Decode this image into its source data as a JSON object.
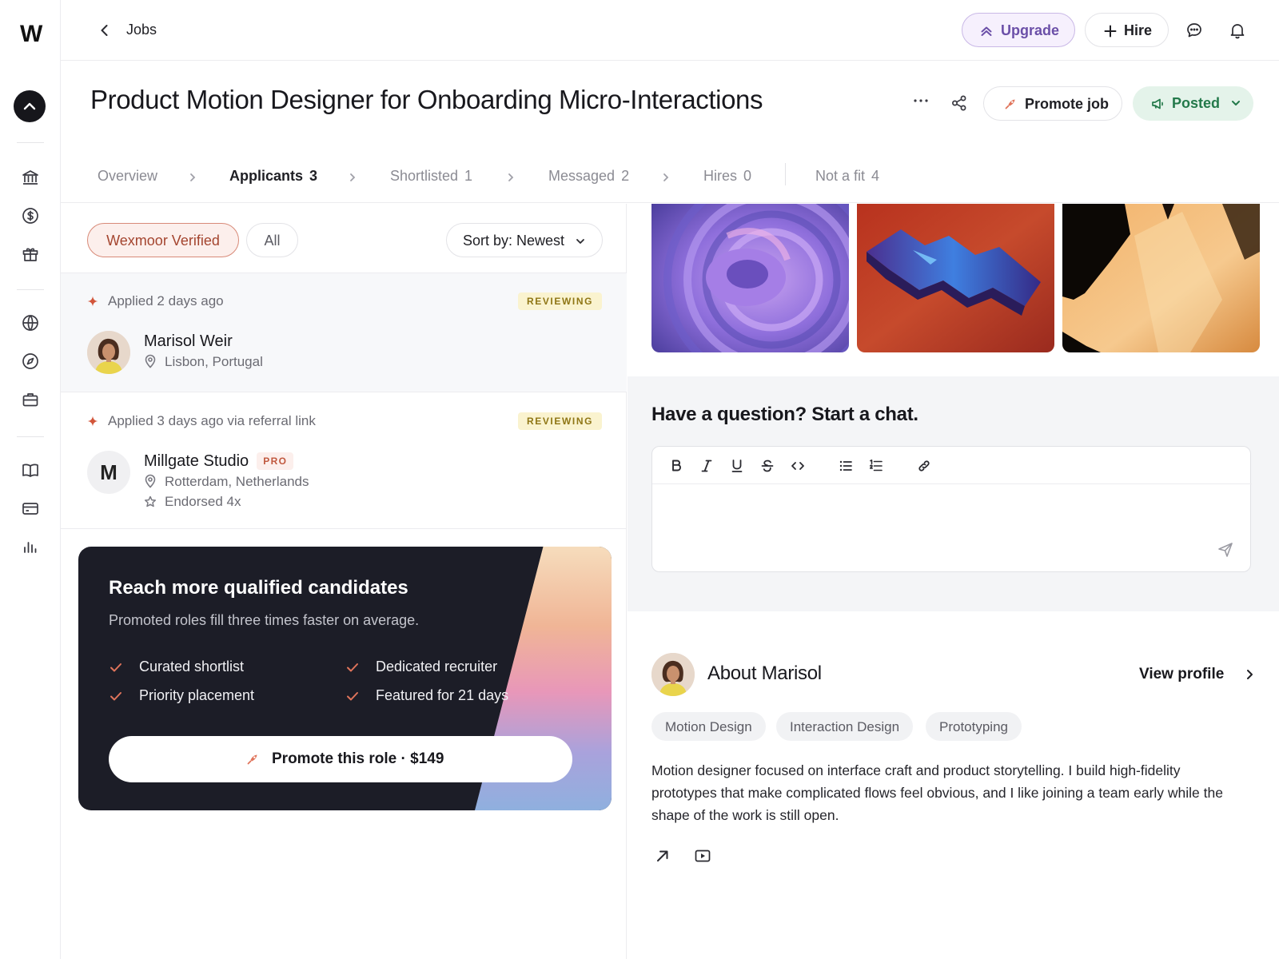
{
  "app": {
    "logo": "W"
  },
  "topbar": {
    "breadcrumb": "Jobs",
    "upgrade_label": "Upgrade",
    "hire_label": "Hire"
  },
  "job": {
    "title": "Product Motion Designer for Onboarding Micro-Interactions",
    "promote_label": "Promote job",
    "status_label": "Posted"
  },
  "tabs": [
    {
      "label": "Overview",
      "count": ""
    },
    {
      "label": "Applicants",
      "count": "3"
    },
    {
      "label": "Shortlisted",
      "count": "1"
    },
    {
      "label": "Messaged",
      "count": "2"
    },
    {
      "label": "Hires",
      "count": "0"
    },
    {
      "label": "Not a fit",
      "count": "4"
    }
  ],
  "filters": {
    "verified_label": "Wexmoor Verified",
    "all_label": "All",
    "sort_label": "Sort by: Newest"
  },
  "applicants": [
    {
      "applied": "Applied 2 days ago",
      "status": "REVIEWING",
      "name": "Marisol Weir",
      "location": "Lisbon, Portugal"
    },
    {
      "applied": "Applied 3 days ago via referral link",
      "status": "REVIEWING",
      "name": "Millgate Studio",
      "initial": "M",
      "badge": "PRO",
      "location": "Rotterdam, Netherlands",
      "endorsed": "Endorsed 4x"
    }
  ],
  "promo": {
    "title": "Reach more qualified candidates",
    "subtitle": "Promoted roles fill three times faster on average.",
    "features": [
      "Curated shortlist",
      "Dedicated recruiter",
      "Priority placement",
      "Featured for 21 days"
    ],
    "button_label": "Promote this role · $149"
  },
  "chat": {
    "heading": "Have a question? Start a chat."
  },
  "about": {
    "title": "About Marisol",
    "view_profile": "View profile",
    "skills": [
      "Motion Design",
      "Interaction Design",
      "Prototyping"
    ],
    "bio": "Motion designer focused on interface craft and product storytelling. I build high-fidelity prototypes that make complicated flows feel obvious, and I like joining a team early while the shape of the work is still open."
  },
  "colors": {
    "accent_verified": "#a4452f",
    "posted_green": "#23794a",
    "upgrade_purple": "#6b4fa8",
    "reviewing_badge": "#8f7615",
    "promo_bg": "#1c1d27"
  }
}
